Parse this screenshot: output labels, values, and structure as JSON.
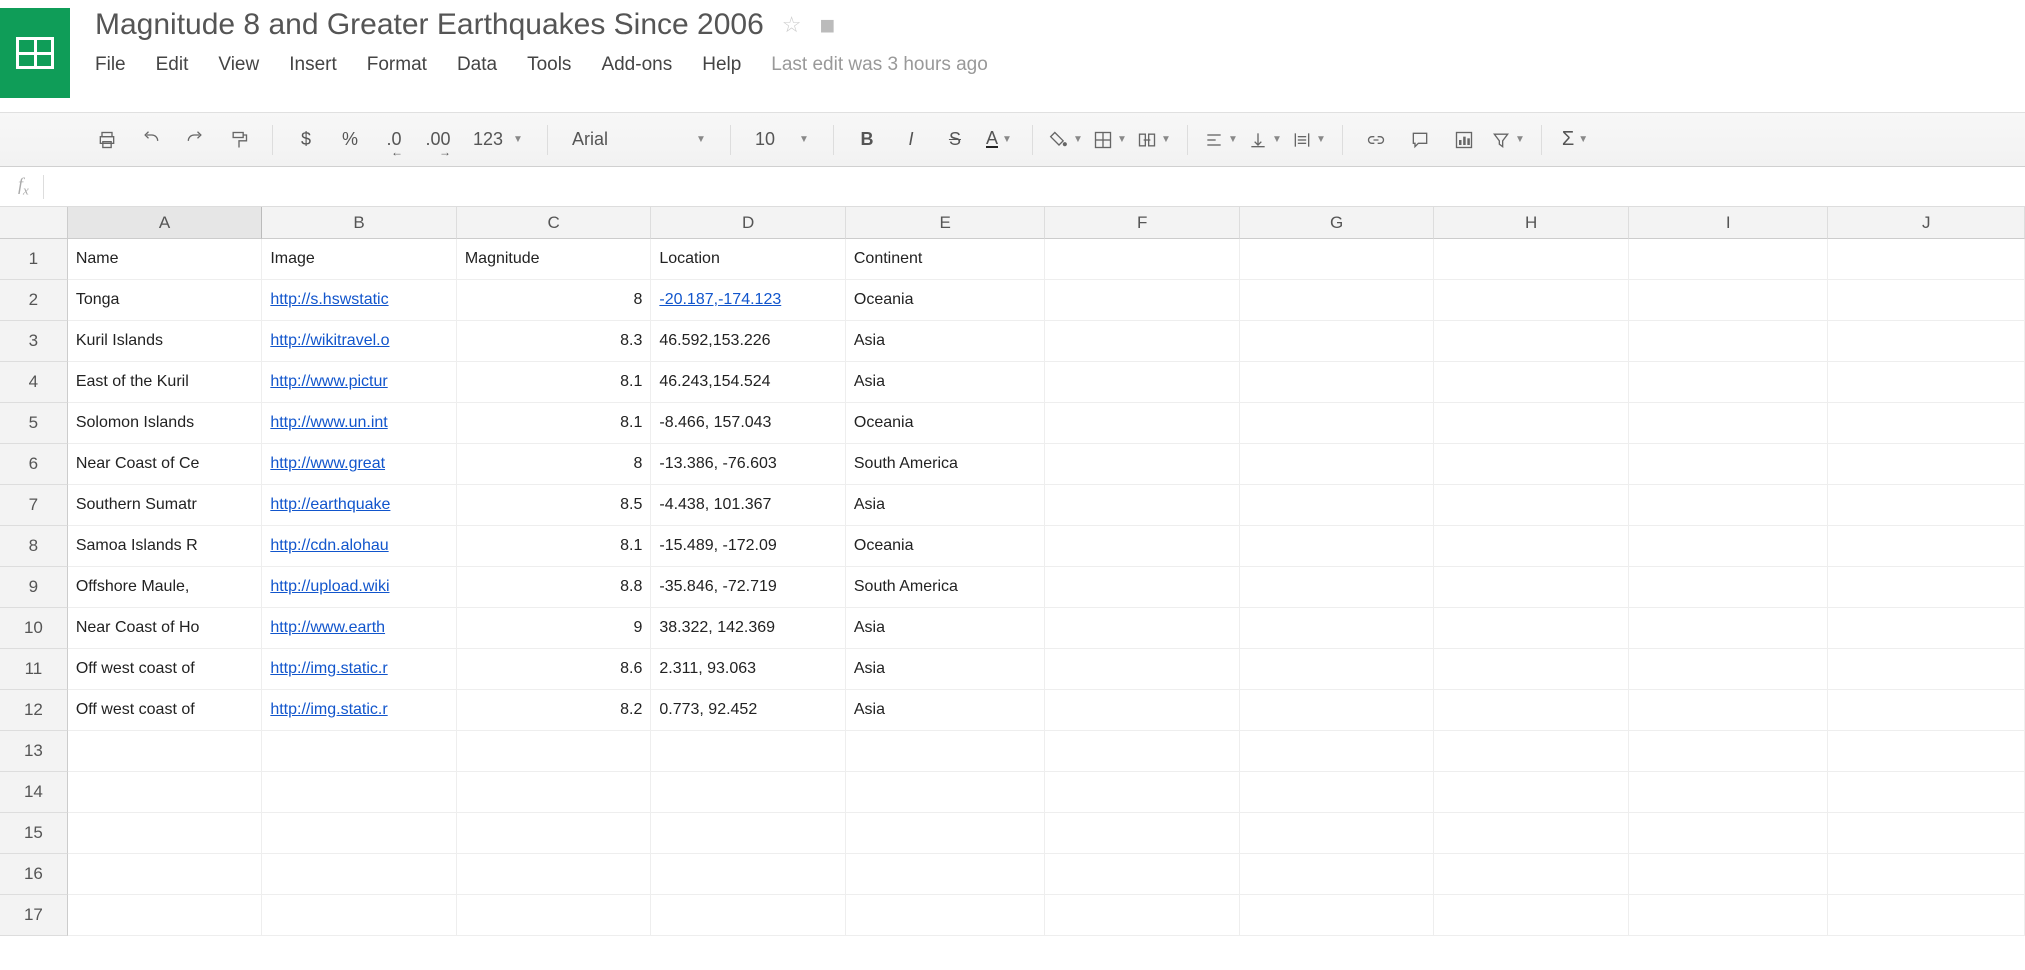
{
  "doc": {
    "title": "Magnitude 8 and Greater Earthquakes Since 2006",
    "last_edit": "Last edit was 3 hours ago"
  },
  "menu": {
    "file": "File",
    "edit": "Edit",
    "view": "View",
    "insert": "Insert",
    "format": "Format",
    "data": "Data",
    "tools": "Tools",
    "addons": "Add-ons",
    "help": "Help"
  },
  "toolbar": {
    "dollar": "$",
    "percent": "%",
    "dec_dec": ".0",
    "inc_dec": ".00",
    "fmt123": "123",
    "font": "Arial",
    "size": "10",
    "bold": "B",
    "italic": "I",
    "strike": "S",
    "textcolor": "A"
  },
  "columns": [
    "A",
    "B",
    "C",
    "D",
    "E",
    "F",
    "G",
    "H",
    "I",
    "J"
  ],
  "headers": {
    "A": "Name",
    "B": "Image",
    "C": "Magnitude",
    "D": "Location",
    "E": "Continent"
  },
  "rows": [
    {
      "A": "Tonga",
      "B": "http://s.hswstatic",
      "C": "8",
      "D": "-20.187,-174.123",
      "D_link": true,
      "E": "Oceania"
    },
    {
      "A": "Kuril Islands",
      "B": "http://wikitravel.o",
      "C": "8.3",
      "D": "46.592,153.226",
      "E": "Asia"
    },
    {
      "A": "East of the Kuril",
      "B": "http://www.pictur",
      "C": "8.1",
      "D": "46.243,154.524",
      "E": "Asia"
    },
    {
      "A": "Solomon Islands",
      "B": "http://www.un.int",
      "C": "8.1",
      "D": "-8.466, 157.043",
      "E": "Oceania"
    },
    {
      "A": "Near Coast of Ce",
      "B": "http://www.great",
      "C": "8",
      "D": "-13.386, -76.603",
      "E": "South America"
    },
    {
      "A": "Southern Sumatr",
      "B": "http://earthquake",
      "C": "8.5",
      "D": "-4.438, 101.367",
      "E": "Asia"
    },
    {
      "A": "Samoa Islands R",
      "B": "http://cdn.alohau",
      "C": "8.1",
      "D": "-15.489, -172.09",
      "E": "Oceania"
    },
    {
      "A": "Offshore Maule,",
      "B": "http://upload.wiki",
      "C": "8.8",
      "D": "-35.846, -72.719",
      "E": "South America"
    },
    {
      "A": "Near Coast of Ho",
      "B": "http://www.earth",
      "C": "9",
      "D": "38.322, 142.369",
      "E": "Asia"
    },
    {
      "A": "Off west coast of",
      "B": "http://img.static.r",
      "C": "8.6",
      "D": "2.311, 93.063",
      "E": "Asia"
    },
    {
      "A": "Off west coast of",
      "B": "http://img.static.r",
      "C": "8.2",
      "D": "0.773, 92.452",
      "E": "Asia"
    }
  ],
  "total_rows": 17,
  "selected_col": "A"
}
